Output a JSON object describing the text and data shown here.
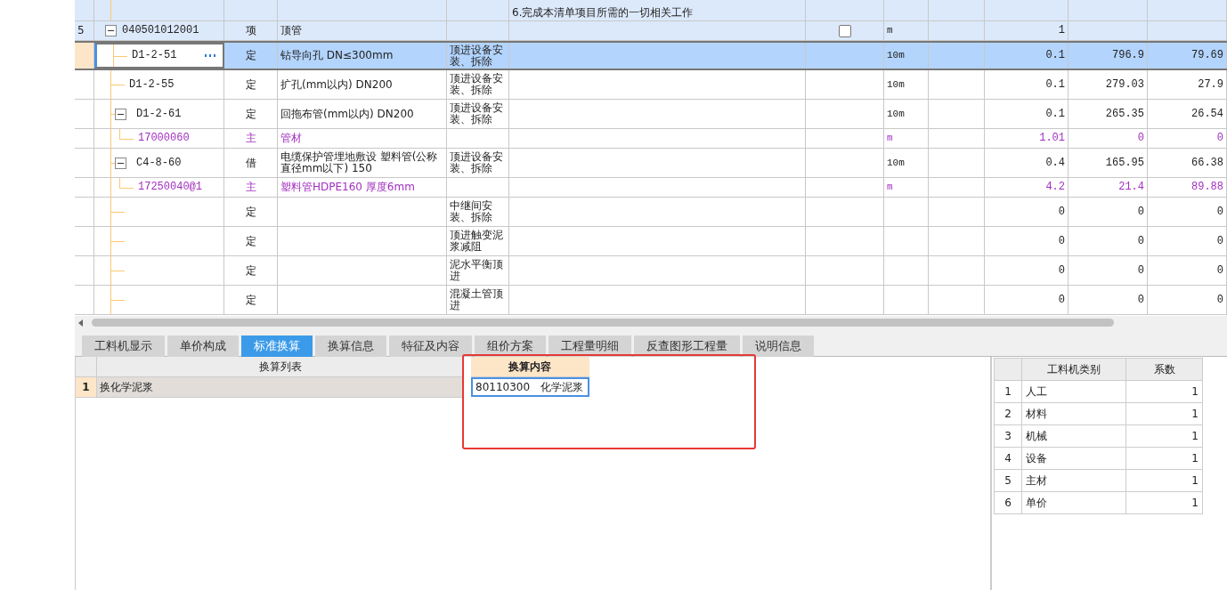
{
  "grid": {
    "partial_row": {
      "description": "6.完成本清单项目所需的一切相关工作"
    },
    "rows": [
      {
        "row_number": "5",
        "code": "040501012001",
        "type": "项",
        "kind": "item",
        "name": "顶管",
        "expanded": true,
        "checkbox": {
          "checked": false
        },
        "unit": "m",
        "quantity": "1",
        "selected": false,
        "children": [
          {
            "code": "D1-2-51",
            "type": "定",
            "kind": "quota",
            "name": "钻导向孔 DN≤300mm",
            "work": "顶进设备安装、拆除",
            "unit": "10m",
            "quantity": "0.1",
            "price": "796.9",
            "total": "79.69",
            "selected": true
          },
          {
            "code": "D1-2-55",
            "type": "定",
            "kind": "quota",
            "name": "扩孔(mm以内) DN200",
            "work": "顶进设备安装、拆除",
            "unit": "10m",
            "quantity": "0.1",
            "price": "279.03",
            "total": "27.9",
            "selected": false
          },
          {
            "code": "D1-2-61",
            "type": "定",
            "kind": "quota",
            "name": "回拖布管(mm以内) DN200",
            "work": "顶进设备安装、拆除",
            "unit": "10m",
            "quantity": "0.1",
            "price": "265.35",
            "total": "26.54",
            "selected": false,
            "expanded": true,
            "children": [
              {
                "code": "17000060",
                "type": "主",
                "kind": "material",
                "name": "管材",
                "unit": "m",
                "quantity": "1.01",
                "price": "0",
                "total": "0",
                "selected": false
              }
            ]
          },
          {
            "code": "C4-8-60",
            "type": "借",
            "kind": "quota",
            "name": "电缆保护管埋地敷设 塑料管(公称直径mm以下) 150",
            "work": "顶进设备安装、拆除",
            "unit": "10m",
            "quantity": "0.4",
            "price": "165.95",
            "total": "66.38",
            "selected": false,
            "expanded": true,
            "children": [
              {
                "code": "17250040@1",
                "type": "主",
                "kind": "material",
                "name": "塑料管HDPE160 厚度6mm",
                "unit": "m",
                "quantity": "4.2",
                "price": "21.4",
                "total": "89.88",
                "selected": false
              }
            ]
          },
          {
            "type": "定",
            "kind": "quota",
            "work": "中继间安装、拆除",
            "quantity": "0",
            "price": "0",
            "total": "0",
            "selected": false
          },
          {
            "type": "定",
            "kind": "quota",
            "work": "顶进触变泥浆减阻",
            "quantity": "0",
            "price": "0",
            "total": "0",
            "selected": false
          },
          {
            "type": "定",
            "kind": "quota",
            "work": "泥水平衡顶进",
            "quantity": "0",
            "price": "0",
            "total": "0",
            "selected": false
          },
          {
            "type": "定",
            "kind": "quota",
            "work": "混凝土管顶进",
            "quantity": "0",
            "price": "0",
            "total": "0",
            "selected": false
          }
        ]
      }
    ]
  },
  "tabs": [
    {
      "label": "工料机显示",
      "selected": false
    },
    {
      "label": "单价构成",
      "selected": false
    },
    {
      "label": "标准换算",
      "selected": true
    },
    {
      "label": "换算信息",
      "selected": false
    },
    {
      "label": "特征及内容",
      "selected": false
    },
    {
      "label": "组价方案",
      "selected": false
    },
    {
      "label": "工程量明细",
      "selected": false
    },
    {
      "label": "反查图形工程量",
      "selected": false
    },
    {
      "label": "说明信息",
      "selected": false
    }
  ],
  "conversion": {
    "list_header": "换算列表",
    "rows": [
      {
        "row_number": "1",
        "name": "换化学泥浆"
      }
    ],
    "content_header": "换算内容",
    "content_value": "80110300   化学泥浆"
  },
  "factors": {
    "columns": [
      "工料机类别",
      "系数"
    ],
    "rows": [
      {
        "row_number": "1",
        "category": "人工",
        "factor": "1"
      },
      {
        "row_number": "2",
        "category": "材料",
        "factor": "1"
      },
      {
        "row_number": "3",
        "category": "机械",
        "factor": "1"
      },
      {
        "row_number": "4",
        "category": "设备",
        "factor": "1"
      },
      {
        "row_number": "5",
        "category": "主材",
        "factor": "1"
      },
      {
        "row_number": "6",
        "category": "单价",
        "factor": "1"
      }
    ]
  }
}
